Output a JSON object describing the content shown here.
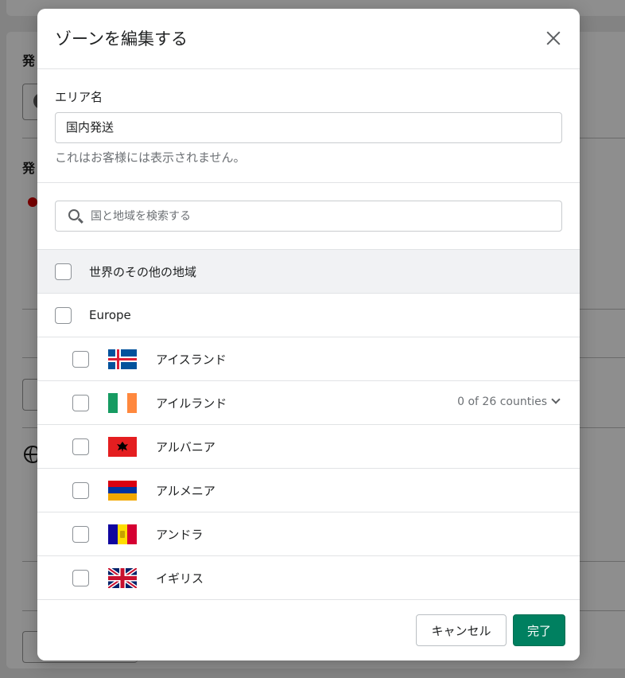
{
  "background": {
    "labels": [
      "発",
      "発"
    ]
  },
  "modal": {
    "title": "ゾーンを編集する",
    "area": {
      "label": "エリア名",
      "value": "国内発送",
      "help": "これはお客様には表示されません。"
    },
    "search": {
      "placeholder": "国と地域を検索する"
    },
    "rows": {
      "rest_of_world": "世界のその他の地域",
      "europe": "Europe",
      "countries": [
        {
          "name": "アイスランド",
          "flag": "iceland"
        },
        {
          "name": "アイルランド",
          "flag": "ireland",
          "counties": "0 of 26 counties"
        },
        {
          "name": "アルバニア",
          "flag": "albania"
        },
        {
          "name": "アルメニア",
          "flag": "armenia"
        },
        {
          "name": "アンドラ",
          "flag": "andorra"
        },
        {
          "name": "イギリス",
          "flag": "uk"
        }
      ]
    },
    "footer": {
      "cancel": "キャンセル",
      "done": "完了"
    }
  },
  "colors": {
    "primary": "#008060",
    "border": "#e1e3e5",
    "muted": "#6d7175"
  }
}
